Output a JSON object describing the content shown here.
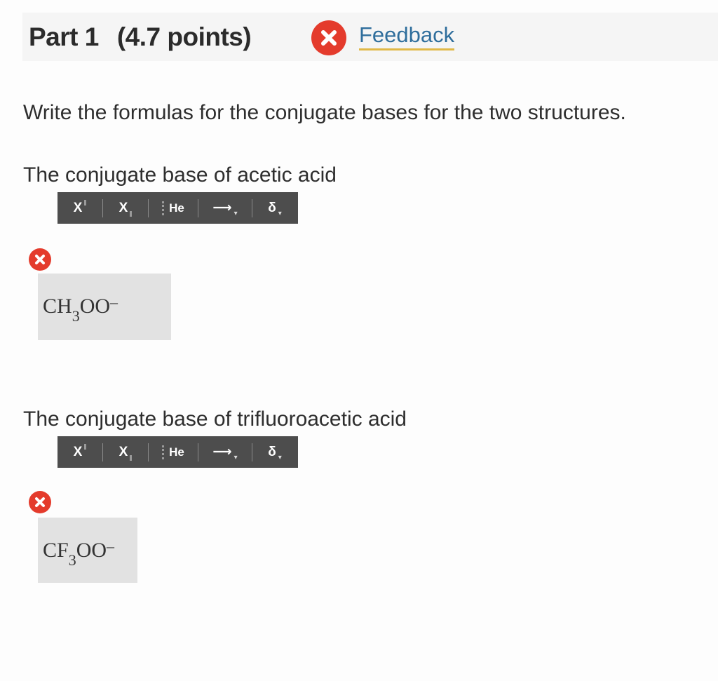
{
  "header": {
    "part_label": "Part 1",
    "points": "(4.7 points)",
    "feedback_icon": "error-x-icon",
    "feedback_link": "Feedback"
  },
  "instructions": "Write the formulas for the conjugate bases for the two structures.",
  "toolbar": {
    "superscript": "X",
    "subscript": "X",
    "element": "He",
    "arrow": "⟶",
    "delta": "δ",
    "caret": "▾"
  },
  "questions": [
    {
      "label": "The conjugate base of acetic acid",
      "status_icon": "error-x-icon",
      "answer": {
        "pre": "CH",
        "sub": "3",
        "post": "OO",
        "sup": "–"
      }
    },
    {
      "label": "The conjugate base of trifluoroacetic acid",
      "status_icon": "error-x-icon",
      "answer": {
        "pre": "CF",
        "sub": "3",
        "post": "OO",
        "sup": "–"
      }
    }
  ],
  "colors": {
    "error": "#e43b2c",
    "link": "#2f6e9c",
    "link_underline": "#e0b847",
    "toolbar_bg": "#4d4d4d",
    "answer_bg": "#e2e2e2"
  }
}
